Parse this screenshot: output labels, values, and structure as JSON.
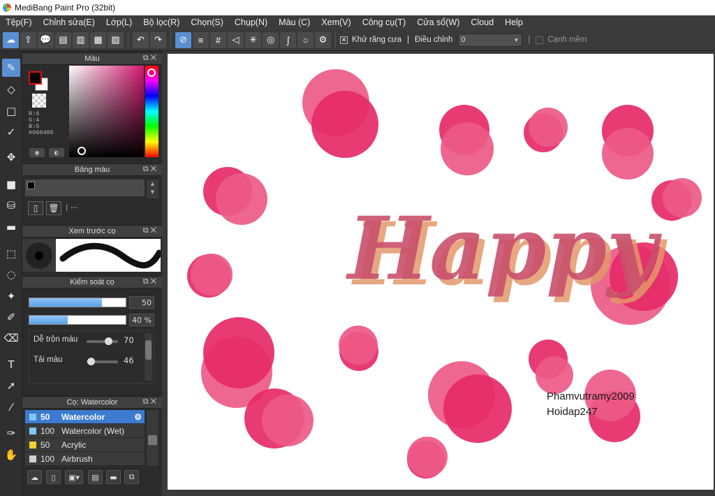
{
  "window": {
    "title": "MediBang Paint Pro (32bit)"
  },
  "menu": [
    "Tệp(F)",
    "Chỉnh sửa(E)",
    "Lớp(L)",
    "Bộ lọc(R)",
    "Chọn(S)",
    "Chụp(N)",
    "Màu (C)",
    "Xem(V)",
    "Công cụ(T)",
    "Cửa sổ(W)",
    "Cloud",
    "Help"
  ],
  "toolbar": {
    "antialias_label": "Khử răng cưa",
    "antialias_checked": true,
    "adjust_label": "Điều chỉnh",
    "adjust_value": "0",
    "soft_edge_label": "Cạnh mềm",
    "soft_edge_checked": false
  },
  "color_panel": {
    "title": "Màu",
    "r": "R:6",
    "g": "G:4",
    "b": "B:5",
    "hex": "#060405",
    "foreground": "#060405",
    "background": "#ffffff"
  },
  "palette_panel": {
    "title": "Bảng màu",
    "footer": "---"
  },
  "brush_preview_panel": {
    "title": "Xem trước cọ"
  },
  "brush_control_panel": {
    "title": "Kiểm soát cọ",
    "size": "50",
    "opacity": "40 %",
    "blend_label": "Dễ trộn màu",
    "blend_value": "70",
    "load_label": "Tải màu",
    "load_value": "46"
  },
  "brush_list_panel": {
    "title": "Cọ: Watercolor",
    "items": [
      {
        "size": "50",
        "name": "Watercolor",
        "color": "#7dc8f5"
      },
      {
        "size": "100",
        "name": "Watercolor (Wet)",
        "color": "#7dc8f5"
      },
      {
        "size": "50",
        "name": "Acrylic",
        "color": "#f2d22c"
      },
      {
        "size": "100",
        "name": "Airbrush",
        "color": "#d0d0d0"
      }
    ]
  },
  "canvas": {
    "headline": "Happy",
    "signature_line1": "Phamvutramy2009",
    "signature_line2": "Hoidap247",
    "accent_light": "#ec5a88",
    "accent_dark": "#e62a68"
  }
}
